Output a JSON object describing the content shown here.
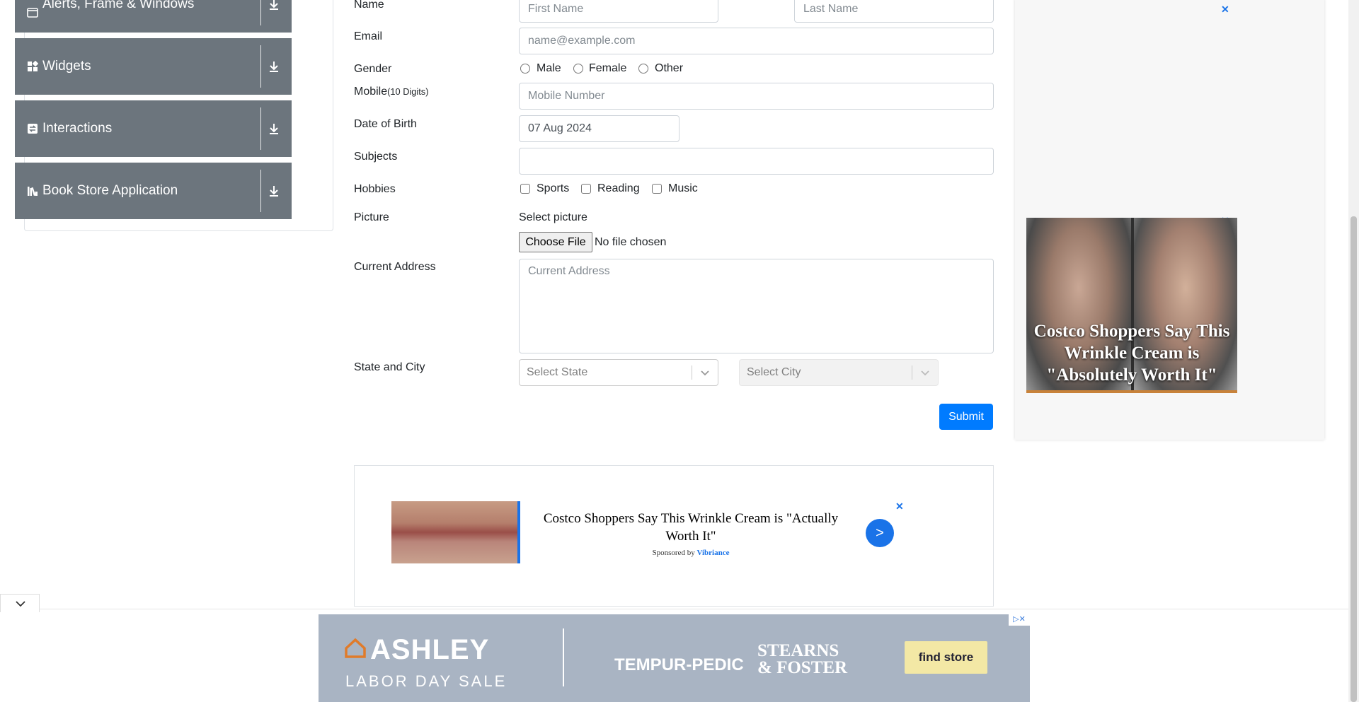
{
  "sidebar": {
    "groups": [
      {
        "label": "Alerts, Frame & Windows",
        "icon": "window-icon"
      },
      {
        "label": "Widgets",
        "icon": "widgets-icon"
      },
      {
        "label": "Interactions",
        "icon": "interactions-icon"
      },
      {
        "label": "Book Store Application",
        "icon": "books-icon"
      }
    ]
  },
  "form": {
    "name_label": "Name",
    "first_name_placeholder": "First Name",
    "last_name_placeholder": "Last Name",
    "email_label": "Email",
    "email_placeholder": "name@example.com",
    "gender_label": "Gender",
    "gender_options": [
      "Male",
      "Female",
      "Other"
    ],
    "mobile_label": "Mobile",
    "mobile_hint": "(10 Digits)",
    "mobile_placeholder": "Mobile Number",
    "dob_label": "Date of Birth",
    "dob_value": "07 Aug 2024",
    "subjects_label": "Subjects",
    "hobbies_label": "Hobbies",
    "hobbies_options": [
      "Sports",
      "Reading",
      "Music"
    ],
    "picture_label": "Picture",
    "picture_caption": "Select picture",
    "choose_file_label": "Choose File",
    "no_file_text": "No file chosen",
    "address_label": "Current Address",
    "address_placeholder": "Current Address",
    "state_city_label": "State and City",
    "state_placeholder": "Select State",
    "city_placeholder": "Select City",
    "submit_label": "Submit"
  },
  "ads": {
    "right_headline": "Costco Shoppers Say This Wrinkle Cream is \"Absolutely Worth It\"",
    "close_symbol": "✕",
    "mid_title": "Costco Shoppers Say This Wrinkle Cream is \"Actually Worth It\"",
    "mid_sponsored_prefix": "Sponsored by",
    "mid_sponsor": "Vibriance",
    "mid_go": ">",
    "banner_brand": "ASHLEY",
    "banner_sale": "LABOR DAY SALE",
    "banner_partner1": "TEMPUR-PEDIC",
    "banner_partner2_line1": "STEARNS",
    "banner_partner2_line2": "& FOSTER",
    "banner_cta": "find store"
  },
  "colors": {
    "primary": "#007bff",
    "nav_bg": "#6c757d",
    "ad_link": "#1a73e8"
  }
}
